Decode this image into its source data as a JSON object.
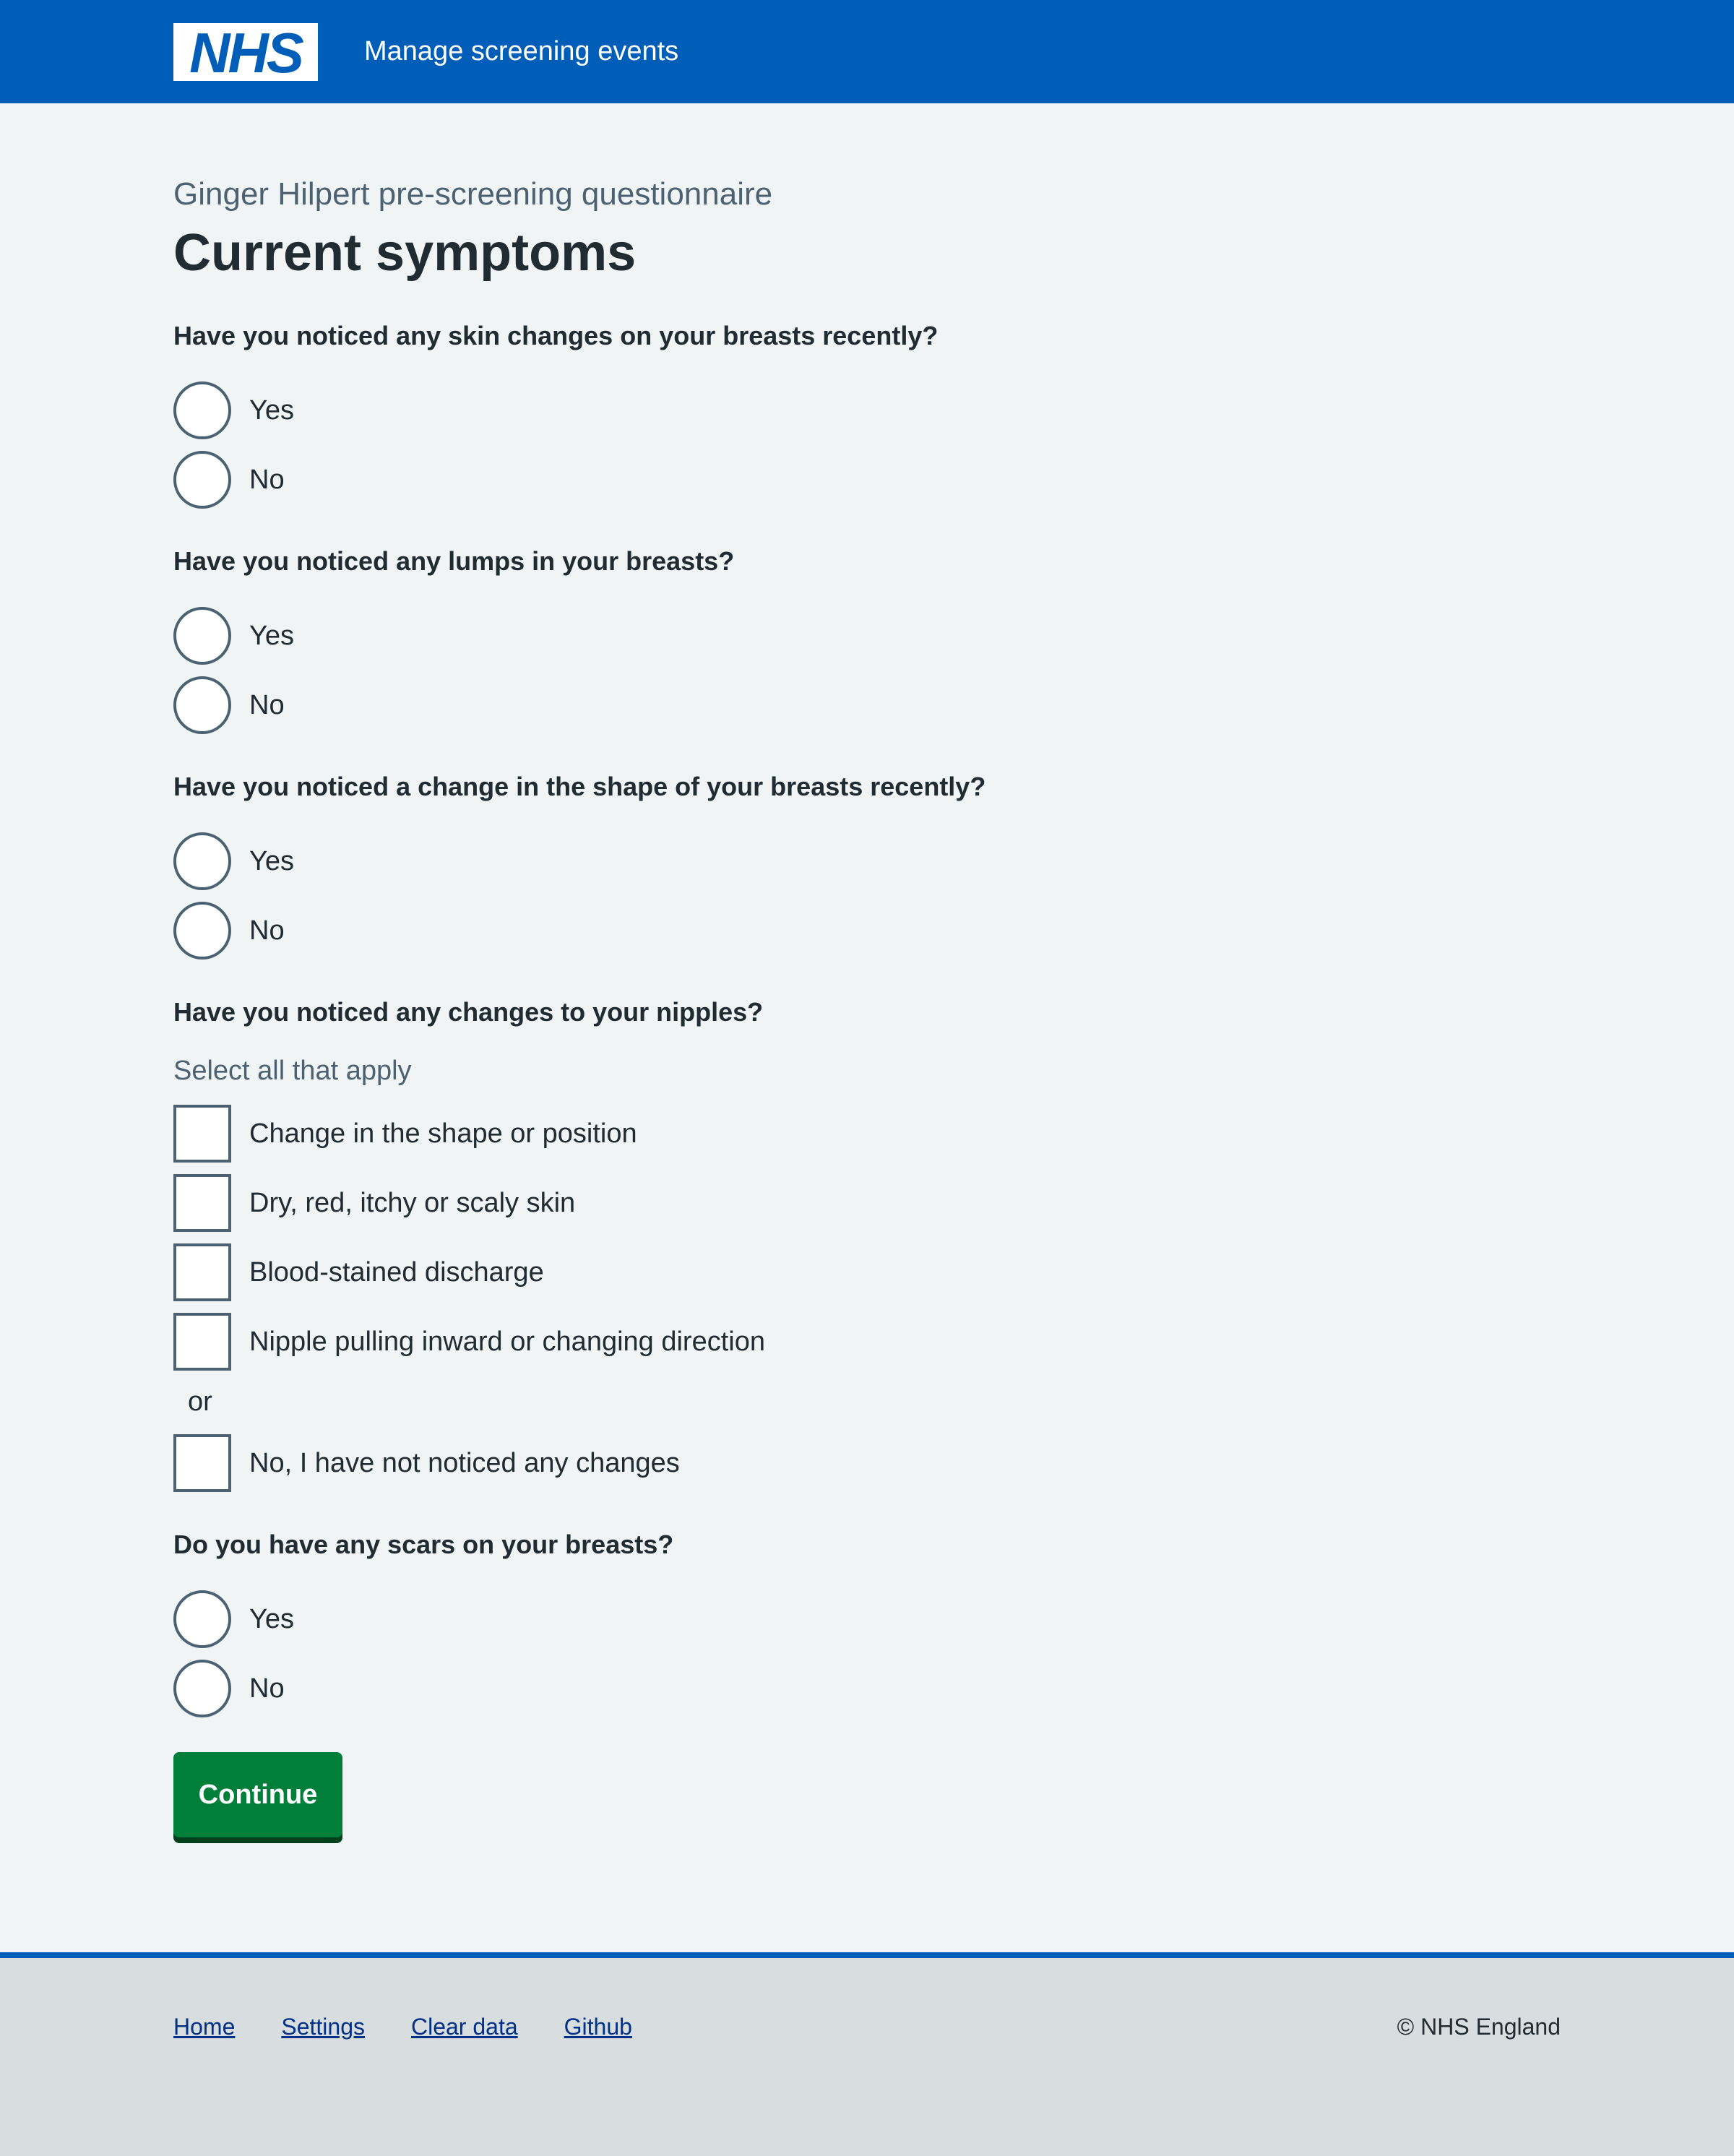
{
  "header": {
    "logo": "NHS",
    "service_name": "Manage screening events"
  },
  "page": {
    "caption": "Ginger Hilpert pre-screening questionnaire",
    "title": "Current symptoms"
  },
  "questions": [
    {
      "text": "Have you noticed any skin changes on your breasts recently?",
      "options": [
        "Yes",
        "No"
      ]
    },
    {
      "text": "Have you noticed any lumps in your breasts?",
      "options": [
        "Yes",
        "No"
      ]
    },
    {
      "text": "Have you noticed a change in the shape of your breasts recently?",
      "options": [
        "Yes",
        "No"
      ]
    },
    {
      "text": "Have you noticed any changes to your nipples?",
      "hint": "Select all that apply",
      "options": [
        "Change in the shape or position",
        "Dry, red, itchy or scaly skin",
        "Blood-stained discharge",
        "Nipple pulling inward or changing direction"
      ],
      "divider": "or",
      "exclusive_option": "No, I have not noticed any changes"
    },
    {
      "text": "Do you have any scars on your breasts?",
      "options": [
        "Yes",
        "No"
      ]
    }
  ],
  "continue_label": "Continue",
  "footer": {
    "links": [
      "Home",
      "Settings",
      "Clear data",
      "Github"
    ],
    "copyright": "© NHS England"
  },
  "colors": {
    "brand_blue": "#005eb8",
    "button_green": "#007f3b",
    "page_background": "#f0f4f5",
    "footer_background": "#d8dde0",
    "text": "#212b32",
    "secondary_text": "#4c6272",
    "link": "#003087"
  }
}
